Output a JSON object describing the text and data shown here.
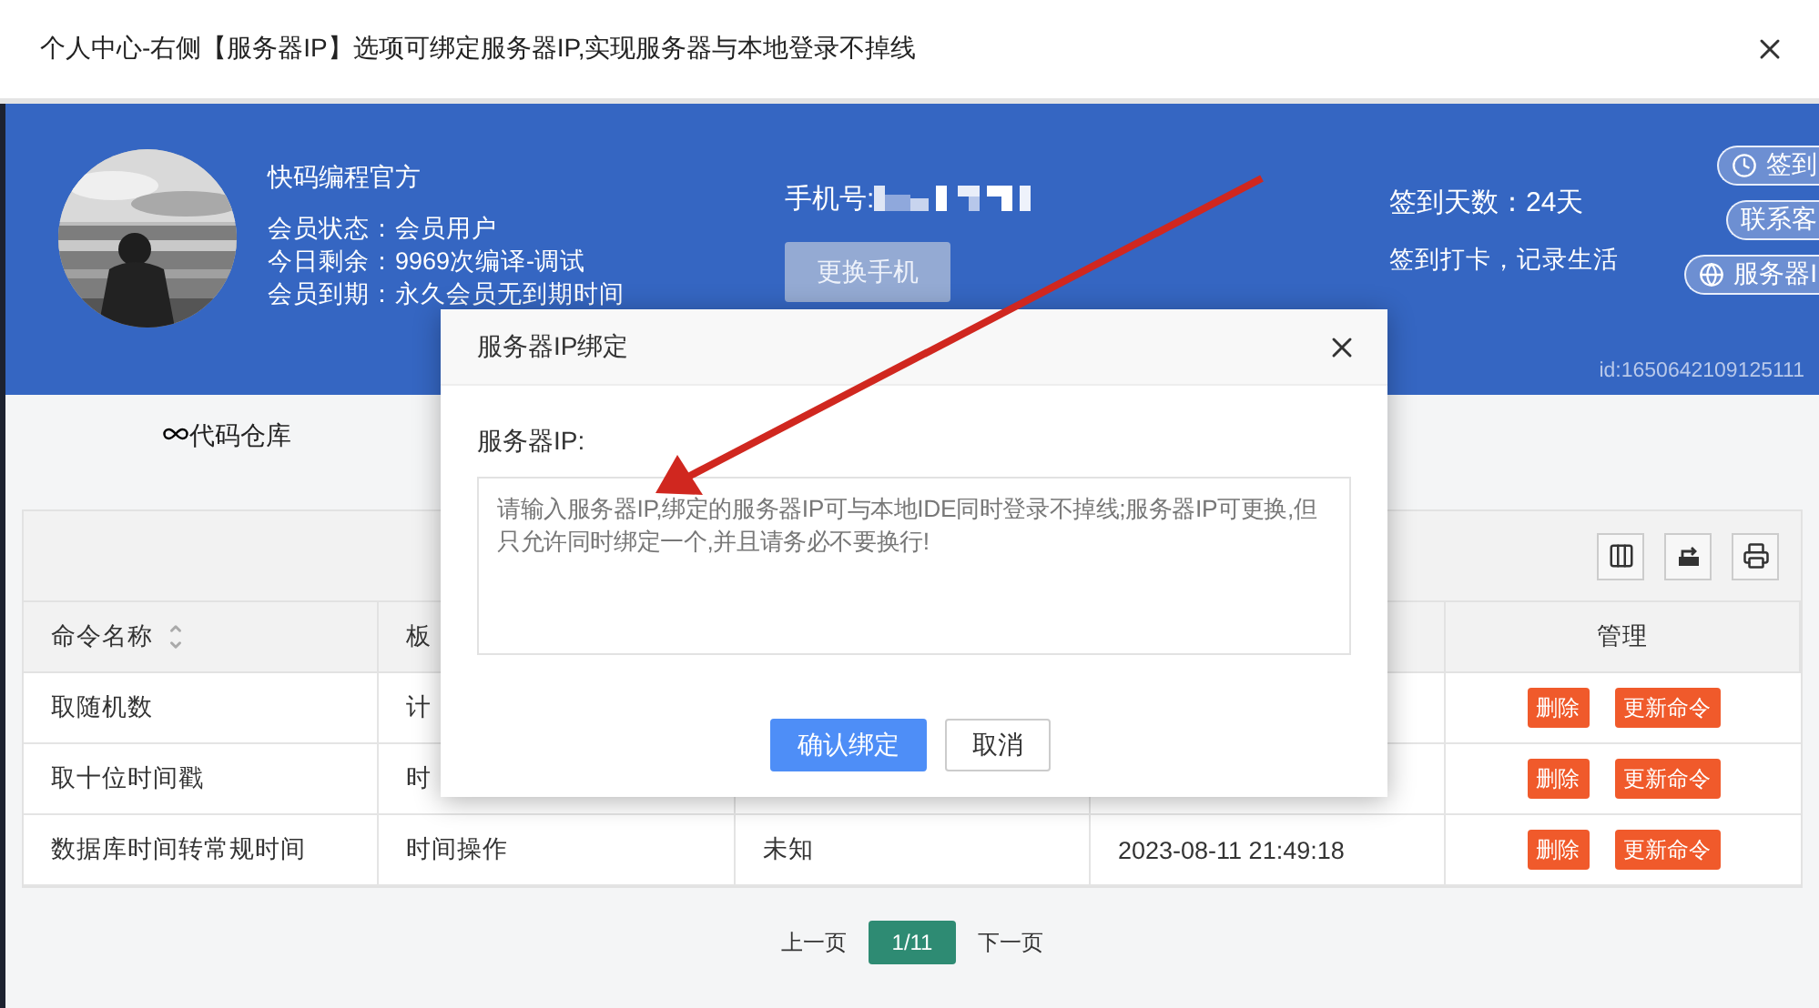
{
  "window": {
    "title": "个人中心-右侧【服务器IP】选项可绑定服务器IP,实现服务器与本地登录不掉线"
  },
  "profile": {
    "name": "快码编程官方",
    "lines": [
      {
        "label": "会员状态：",
        "value": "会员用户"
      },
      {
        "label": "今日剩余：",
        "value": "9969次编译-调试"
      },
      {
        "label": "会员到期：",
        "value": "永久会员无到期时间"
      }
    ]
  },
  "phone": {
    "label": "手机号:",
    "button": "更换手机"
  },
  "checkin": {
    "days": "签到天数：24天",
    "slogan": "签到打卡，记录生活"
  },
  "side_buttons": [
    {
      "label": "签到",
      "kind": "checkin"
    },
    {
      "label": "联系客",
      "kind": "contact"
    },
    {
      "label": "服务器I",
      "kind": "server"
    }
  ],
  "user_id": "id:1650642109125111",
  "tab": {
    "label": "代码仓库"
  },
  "table": {
    "columns": [
      "命令名称",
      "板",
      "管理"
    ],
    "rows": [
      {
        "cells": [
          "取随机数",
          "计"
        ],
        "actions": [
          "删除",
          "更新命令"
        ]
      },
      {
        "cells": [
          "取十位时间戳",
          "时"
        ],
        "actions": [
          "删除",
          "更新命令"
        ]
      },
      {
        "cells": [
          "数据库时间转常规时间",
          "时间操作",
          "未知",
          "2023-08-11 21:49:18"
        ],
        "actions": [
          "删除",
          "更新命令"
        ]
      }
    ]
  },
  "pagination": {
    "prev": "上一页",
    "pages": [
      {
        "label": "1/11",
        "selected": true
      }
    ],
    "next": "下一页"
  },
  "modal": {
    "title": "服务器IP绑定",
    "field_label": "服务器IP:",
    "placeholder": "请输入服务器IP,绑定的服务器IP可与本地IDE同时登录不掉线;服务器IP可更换,但只允许同时绑定一个,并且请务必不要换行!",
    "buttons": [
      {
        "label": "确认绑定",
        "kind": "primary"
      },
      {
        "label": "取消",
        "kind": "default"
      }
    ]
  }
}
